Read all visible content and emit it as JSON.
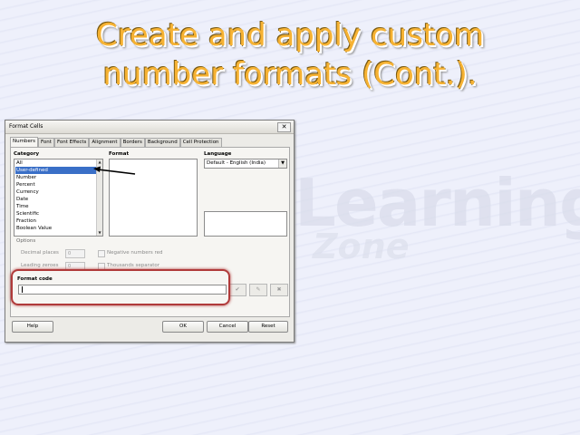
{
  "slide": {
    "title_line1": "Create and apply custom",
    "title_line2": "number formats (Cont.).",
    "watermark_line1": "Learning",
    "watermark_line2": "Zone"
  },
  "dialog": {
    "title": "Format Cells",
    "close_glyph": "✕",
    "tabs": [
      "Numbers",
      "Font",
      "Font Effects",
      "Alignment",
      "Borders",
      "Background",
      "Cell Protection"
    ],
    "category_label": "Category",
    "categories": [
      "All",
      "User-defined",
      "Number",
      "Percent",
      "Currency",
      "Date",
      "Time",
      "Scientific",
      "Fraction",
      "Boolean Value"
    ],
    "selected_category": "User-defined",
    "format_label": "Format",
    "language_label": "Language",
    "language_value": "Default - English (India)",
    "options_label": "Options",
    "decimal_places_label": "Decimal places",
    "decimal_places_value": "0",
    "leading_zeroes_label": "Leading zeroes",
    "leading_zeroes_value": "0",
    "negative_numbers_red_label": "Negative numbers red",
    "thousands_separator_label": "Thousands separator",
    "format_code_label": "Format code",
    "format_code_value": "",
    "buttons": {
      "help": "Help",
      "ok": "OK",
      "cancel": "Cancel",
      "reset": "Reset"
    },
    "icon_buttons": {
      "accept": "✔",
      "edit_comment": "✎",
      "delete": "✖"
    }
  },
  "colors": {
    "title": "#f6b233",
    "selection": "#3a6fc7",
    "highlight": "#b03a3a"
  }
}
